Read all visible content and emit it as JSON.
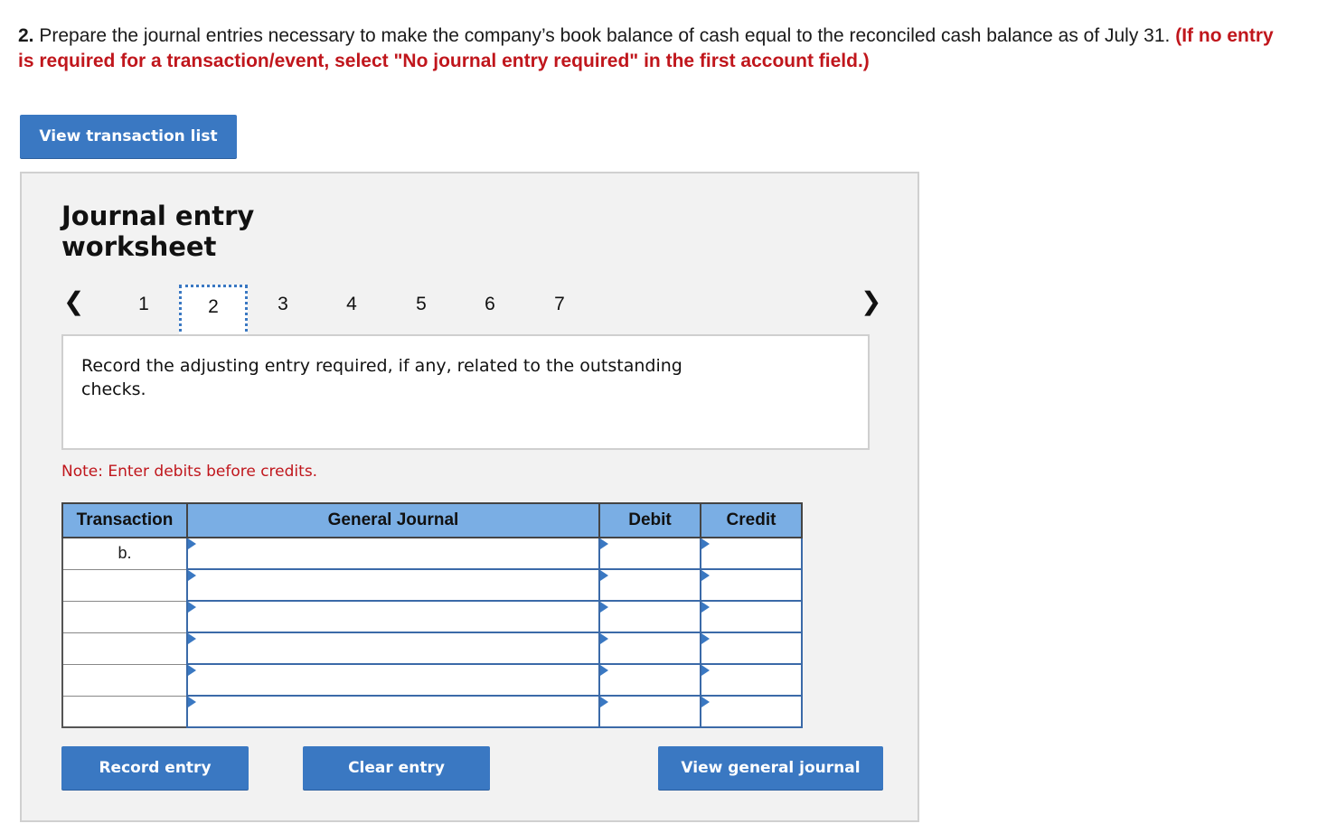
{
  "question": {
    "number": "2.",
    "text": " Prepare the journal entries necessary to make the company’s book balance of cash equal to the reconciled cash balance as of July 31. ",
    "instruction": "(If no entry is required for a transaction/event, select \"No journal entry required\" in the first account field.)"
  },
  "buttons": {
    "view_transaction_list": "View transaction list",
    "record_entry": "Record entry",
    "clear_entry": "Clear entry",
    "view_general_journal": "View general journal"
  },
  "worksheet": {
    "title": "Journal entry worksheet",
    "pages": [
      "1",
      "2",
      "3",
      "4",
      "5",
      "6",
      "7"
    ],
    "active_page": "2",
    "prompt": "Record the adjusting entry required, if any, related to the outstanding checks.",
    "note": "Note: Enter debits before credits."
  },
  "journal": {
    "headers": {
      "transaction": "Transaction",
      "general_journal": "General Journal",
      "debit": "Debit",
      "credit": "Credit"
    },
    "rows": [
      {
        "transaction": "b.",
        "account": "",
        "debit": "",
        "credit": ""
      },
      {
        "transaction": "",
        "account": "",
        "debit": "",
        "credit": ""
      },
      {
        "transaction": "",
        "account": "",
        "debit": "",
        "credit": ""
      },
      {
        "transaction": "",
        "account": "",
        "debit": "",
        "credit": ""
      },
      {
        "transaction": "",
        "account": "",
        "debit": "",
        "credit": ""
      },
      {
        "transaction": "",
        "account": "",
        "debit": "",
        "credit": ""
      }
    ]
  },
  "icons": {
    "prev": "chevron-left-icon",
    "next": "chevron-right-icon",
    "cell_marker": "triangle-right-icon"
  },
  "colors": {
    "button": "#3a78c2",
    "header": "#7aaee4",
    "instruction_red": "#c0161c"
  }
}
